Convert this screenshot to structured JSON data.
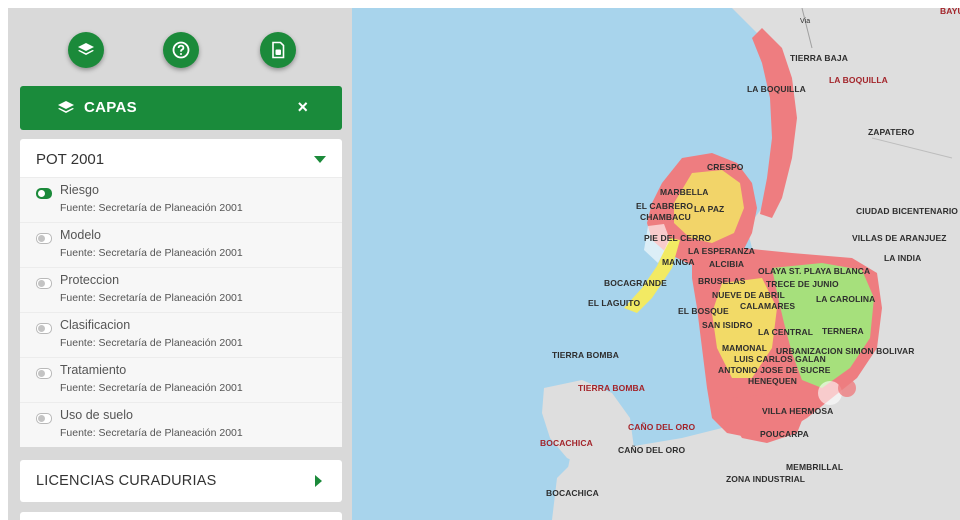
{
  "toolbar": {
    "buttons": [
      {
        "icon": "layers-icon"
      },
      {
        "icon": "help-icon"
      },
      {
        "icon": "document-icon"
      }
    ]
  },
  "capas": {
    "title": "CAPAS",
    "close_label": "×"
  },
  "pot": {
    "title": "POT 2001",
    "layers": [
      {
        "name": "Riesgo",
        "source": "Fuente: Secretaría de Planeación 2001",
        "active": true
      },
      {
        "name": "Modelo",
        "source": "Fuente: Secretaría de Planeación 2001",
        "active": false
      },
      {
        "name": "Proteccion",
        "source": "Fuente: Secretaría de Planeación 2001",
        "active": false
      },
      {
        "name": "Clasificacion",
        "source": "Fuente: Secretaría de Planeación 2001",
        "active": false
      },
      {
        "name": "Tratamiento",
        "source": "Fuente: Secretaría de Planeación 2001",
        "active": false
      },
      {
        "name": "Uso de suelo",
        "source": "Fuente: Secretaría de Planeación 2001",
        "active": false
      }
    ]
  },
  "licencias": {
    "title": "LICENCIAS CURADURIAS"
  },
  "map": {
    "labels": [
      "BAYUN",
      "Via",
      "TIERRA BAJA",
      "LA BOQUILLA",
      "LA BOQUILLA",
      "ZAPATERO",
      "CRESPO",
      "MARBELLA",
      "EL CABRERO",
      "LA PAZ",
      "CHAMBACU",
      "CIUDAD BICENTENARIO",
      "PIE DEL CERRO",
      "VILLAS DE ARANJUEZ",
      "LA ESPERANZA",
      "MANGA",
      "ALCIBIA",
      "LA INDIA",
      "OLAYA ST. PLAYA BLANCA",
      "BOCAGRANDE",
      "BRUSELAS",
      "TRECE DE JUNIO",
      "NUEVE DE ABRIL",
      "LA CAROLINA",
      "CALAMARES",
      "EL LAGUITO",
      "EL BOSQUE",
      "SAN ISIDRO",
      "LA CENTRAL",
      "TERNERA",
      "MAMONAL",
      "URBANIZACION SIMON BOLIVAR",
      "TIERRA BOMBA",
      "LUIS CARLOS GALAN",
      "ANTONIO JOSE DE SUCRE",
      "HENEQUEN",
      "TIERRA BOMBA",
      "VILLA HERMOSA",
      "CAÑO DEL ORO",
      "BOCACHICA",
      "POUCARPA",
      "CAÑO DEL ORO",
      "MEMBRILLAL",
      "ZONA INDUSTRIAL",
      "BOCACHICA"
    ],
    "colors": {
      "water": "#a8d4ec",
      "land": "#dedede",
      "risk_red": "#ee7d80",
      "risk_yellow": "#f2ea63",
      "risk_green": "#a6e07c",
      "brand_green": "#1b8a3a"
    }
  }
}
